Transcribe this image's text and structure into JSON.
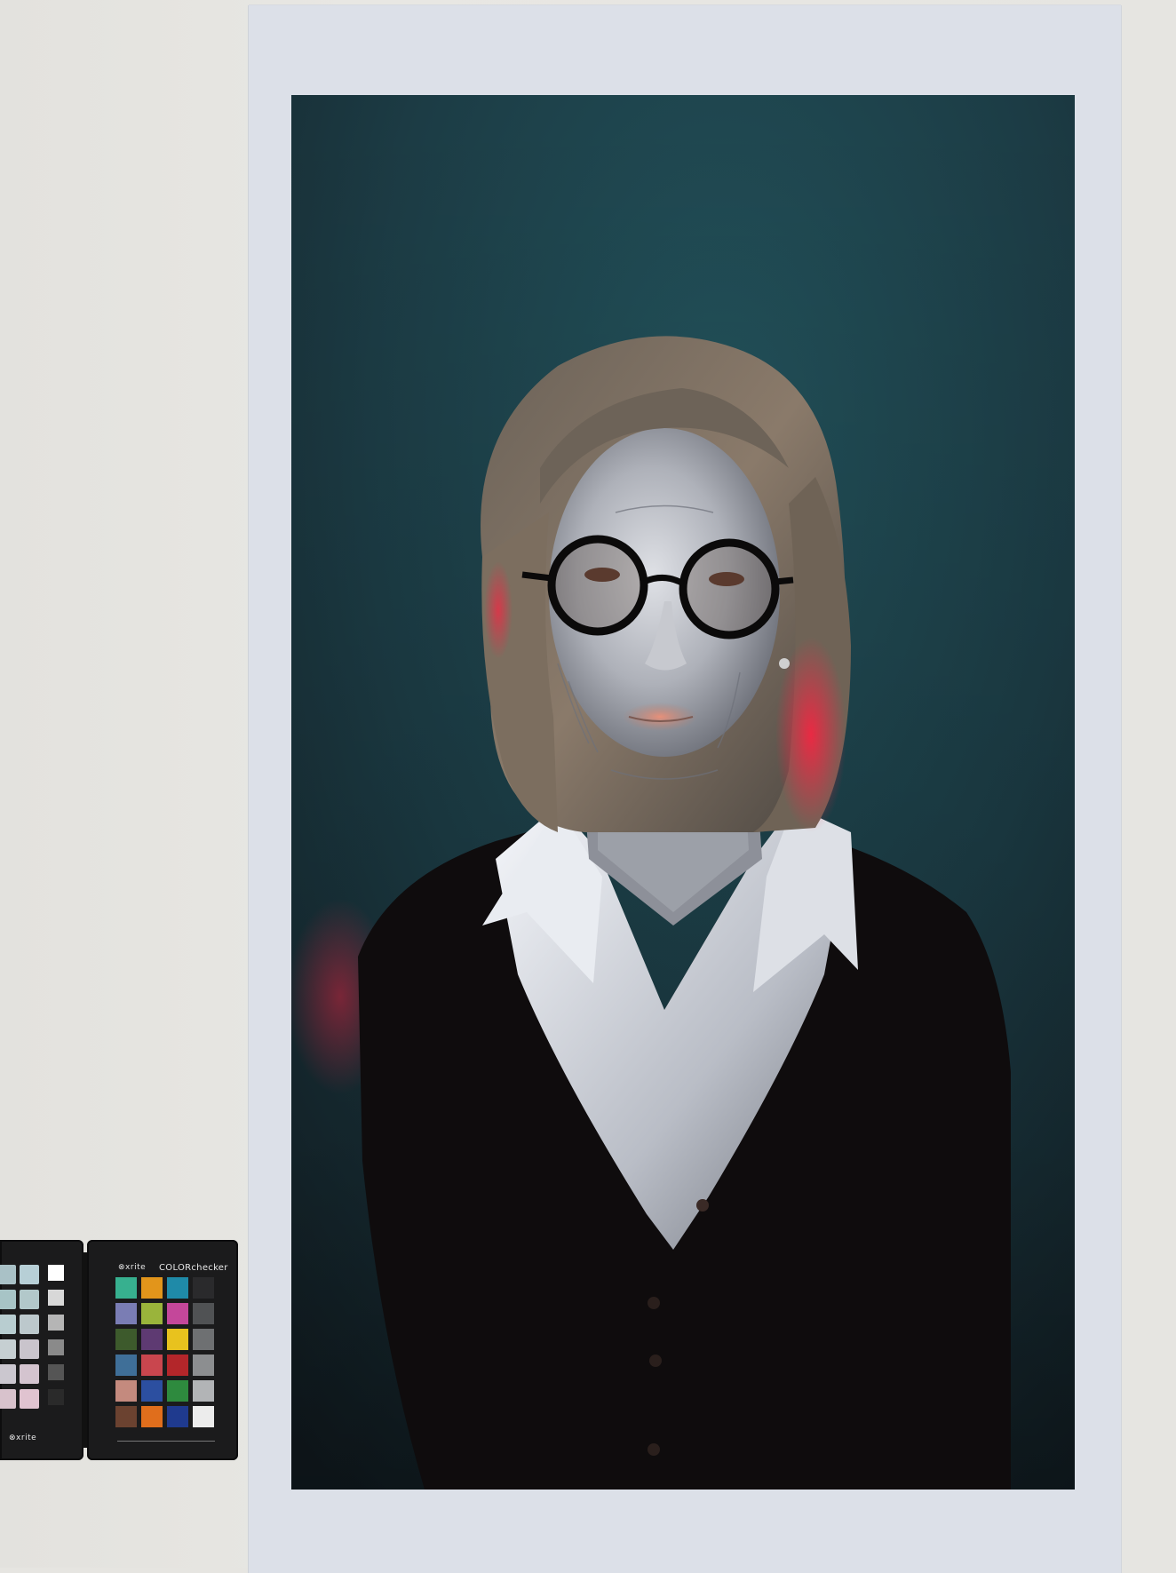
{
  "scene": {
    "wall_color": "#e6e5e1",
    "print_border_color": "#dce0e8",
    "photo_background_color": "#1f4049"
  },
  "color_checker": {
    "brand": "xrite",
    "product": "COLORchecker",
    "patches": [
      "#37b08f",
      "#e2951b",
      "#1f8aa8",
      "#2a2a2c",
      "#7a7db4",
      "#9ab43b",
      "#c4479a",
      "#505254",
      "#3d5a2c",
      "#5e3a72",
      "#e8c21e",
      "#6e7072",
      "#3f6f98",
      "#c9464e",
      "#b3262a",
      "#8c8e90",
      "#c48a7e",
      "#2c4fa0",
      "#2e8a3e",
      "#b2b4b6",
      "#6b4230",
      "#e06e1c",
      "#1f3a8e",
      "#ececec"
    ],
    "left_panel_patches": [
      "#a9c1c6",
      "#b7cfd6",
      "#ffffff",
      "#a7c4c6",
      "#b2c8ca",
      "#d8d8d8",
      "#b8cdd0",
      "#bcc8cc",
      "#b5b5b5",
      "#c6cfd2",
      "#c9c4cc",
      "#8a8a8a",
      "#cbc7cf",
      "#d4c4cf",
      "#555555",
      "#d8c2cc",
      "#e0c3d0",
      "#2a2a2a"
    ]
  }
}
